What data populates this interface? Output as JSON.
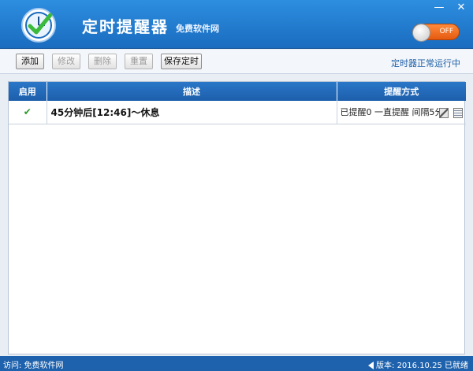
{
  "app": {
    "title": "定时提醒器",
    "subtitle": "免费软件网",
    "toggle_label": "OFF"
  },
  "window": {
    "minimize": "—",
    "close": "✕"
  },
  "toolbar": {
    "add": "添加",
    "edit": "修改",
    "delete": "删除",
    "reset": "重置",
    "save": "保存定时",
    "status": "定时器正常运行中"
  },
  "table": {
    "headers": [
      "启用",
      "描述",
      "提醒方式"
    ],
    "rows": [
      {
        "enabled": "✔",
        "description": "45分钟后[12:46]～休息",
        "mode": "已提醒0  一直提醒  间隔5分"
      }
    ]
  },
  "statusbar": {
    "left": "访问: 免费软件网",
    "right": "版本: 2016.10.25  已就绪"
  },
  "colors": {
    "titlebar": "#1a6cbf",
    "header": "#1d5fab",
    "toggle": "#e55a10",
    "status_text": "#1d5fa7"
  }
}
